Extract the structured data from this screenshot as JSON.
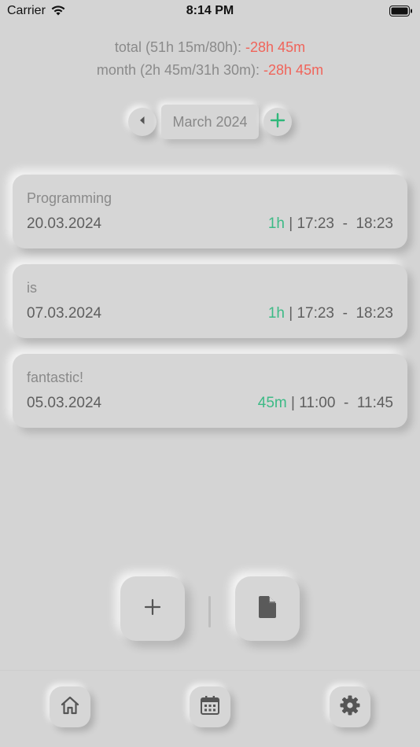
{
  "status_bar": {
    "carrier": "Carrier",
    "time": "8:14 PM"
  },
  "totals": {
    "total_prefix": "total (51h 15m/80h): ",
    "total_diff": "-28h 45m",
    "month_prefix": "month (2h 45m/31h 30m): ",
    "month_diff": "-28h 45m"
  },
  "month_selector": {
    "label": "March 2024"
  },
  "entries": [
    {
      "title": "Programming",
      "date": "20.03.2024",
      "duration": "1h",
      "separator": "|",
      "start": "17:23",
      "dash": "-",
      "end": "18:23"
    },
    {
      "title": "is",
      "date": "07.03.2024",
      "duration": "1h",
      "separator": "|",
      "start": "17:23",
      "dash": "-",
      "end": "18:23"
    },
    {
      "title": "fantastic!",
      "date": "05.03.2024",
      "duration": "45m",
      "separator": "|",
      "start": "11:00",
      "dash": "-",
      "end": "11:45"
    }
  ],
  "colors": {
    "background": "#d4d4d4",
    "negative": "#f0645a",
    "duration": "#3dba86",
    "accent_plus": "#2fb87a"
  },
  "icons": {
    "prev": "triangle-left-icon",
    "add_month": "plus-icon",
    "add_entry": "plus-icon",
    "export": "document-icon",
    "tab_home": "home-icon",
    "tab_calendar": "calendar-icon",
    "tab_settings": "gear-icon"
  }
}
